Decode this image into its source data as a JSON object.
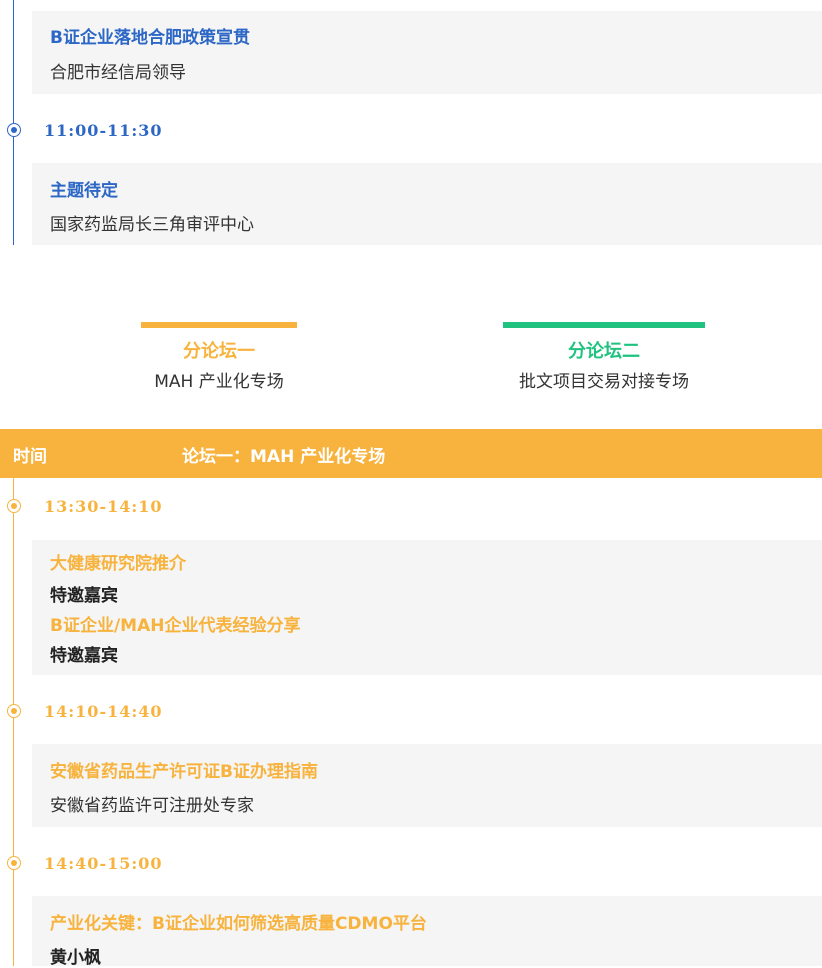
{
  "colors": {
    "blue": "#2d67c6",
    "orange": "#f7b33d",
    "green": "#1fc37f",
    "card_bg": "#f5f5f5"
  },
  "top_session": {
    "item1": {
      "title": "B证企业落地合肥政策宣贯",
      "speaker": "合肥市经信局领导"
    },
    "time2": "11:00-11:30",
    "item2": {
      "title": "主题待定",
      "speaker": "国家药监局长三角审评中心"
    }
  },
  "forum_tabs": [
    {
      "name": "分论坛一",
      "subtitle": "MAH 产业化专场"
    },
    {
      "name": "分论坛二",
      "subtitle": "批文项目交易对接专场"
    }
  ],
  "forum_header": {
    "time_label": "时间",
    "forum_title": "论坛一：MAH 产业化专场"
  },
  "schedule": [
    {
      "time": "13:30-14:10",
      "lines": [
        {
          "text": "大健康研究院推介",
          "kind": "title"
        },
        {
          "text": "特邀嘉宾",
          "kind": "speaker"
        },
        {
          "text": "B证企业/MAH企业代表经验分享",
          "kind": "title"
        },
        {
          "text": "特邀嘉宾",
          "kind": "speaker"
        }
      ]
    },
    {
      "time": "14:10-14:40",
      "lines": [
        {
          "text": "安徽省药品生产许可证B证办理指南",
          "kind": "title"
        },
        {
          "text": "安徽省药监许可注册处专家",
          "kind": "speaker"
        }
      ]
    },
    {
      "time": "14:40-15:00",
      "lines": [
        {
          "text": "产业化关键：B证企业如何筛选高质量CDMO平台",
          "kind": "title"
        },
        {
          "text": "黄小枫",
          "kind": "speaker"
        }
      ]
    }
  ]
}
